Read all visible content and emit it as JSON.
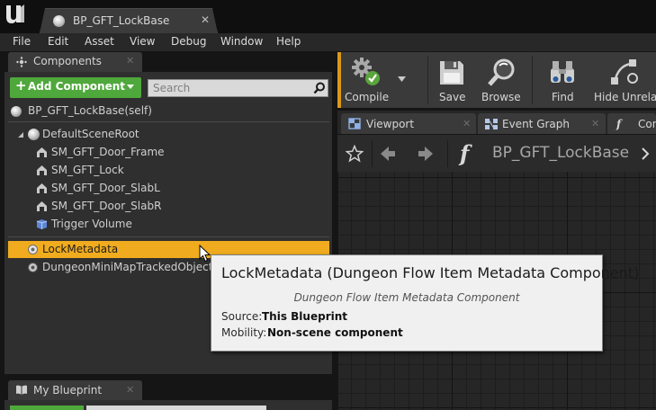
{
  "window": {
    "document_tab": "BP_GFT_LockBase",
    "close_glyph": "✕"
  },
  "menu": [
    "File",
    "Edit",
    "Asset",
    "View",
    "Debug",
    "Window",
    "Help"
  ],
  "components_panel": {
    "tab_label": "Components",
    "add_component_label": "Add Component",
    "add_plus": "+",
    "search_placeholder": "Search",
    "self_item": "BP_GFT_LockBase(self)",
    "root_item": "DefaultSceneRoot",
    "children": [
      "SM_GFT_Door_Frame",
      "SM_GFT_Lock",
      "SM_GFT_Door_SlabL",
      "SM_GFT_Door_SlabR",
      "Trigger Volume"
    ],
    "selected_item": "LockMetadata",
    "other_item": "DungeonMiniMapTrackedObject"
  },
  "my_blueprint": {
    "tab_label": "My Blueprint"
  },
  "toolbar": {
    "compile": "Compile",
    "save": "Save",
    "browse": "Browse",
    "find": "Find",
    "hide_unrelated": "Hide Unrelate"
  },
  "editor_tabs": {
    "viewport": "Viewport",
    "event_graph": "Event Graph",
    "construction": "Con"
  },
  "breadcrumb": {
    "title": "BP_GFT_LockBase",
    "function_glyph": "f"
  },
  "tooltip": {
    "title": "LockMetadata (Dungeon Flow Item Metadata Component)",
    "subtitle": "Dungeon Flow Item Metadata Component",
    "source_key": "Source:",
    "source_value": "This Blueprint",
    "mobility_key": "Mobility:",
    "mobility_value": "Non-scene component"
  },
  "colors": {
    "accent_orange": "#f0ac1e",
    "add_green": "#4fa83b",
    "tooltip_bg": "#f0f0f0"
  }
}
